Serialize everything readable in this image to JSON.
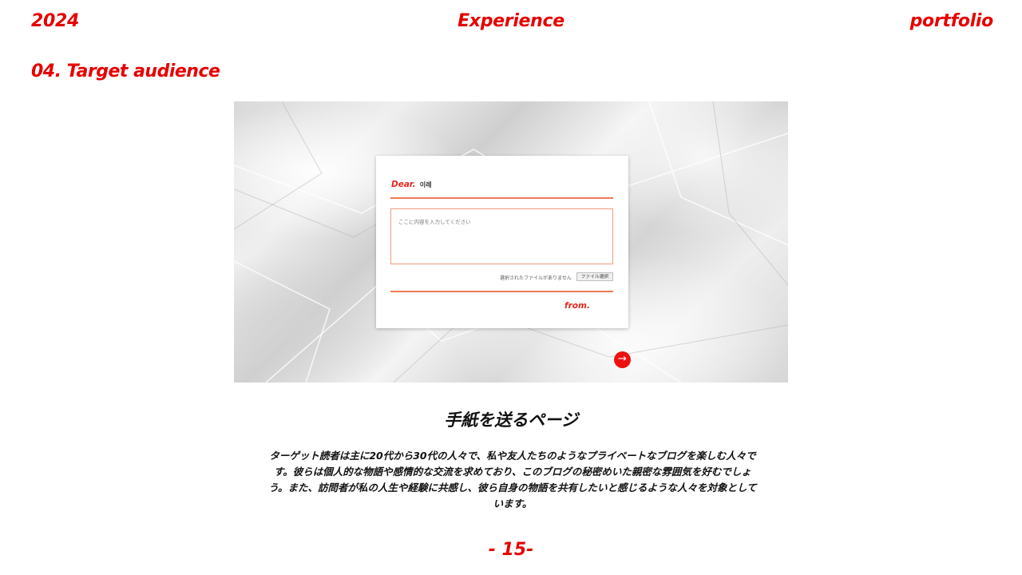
{
  "header": {
    "year": "2024",
    "title": "Experience",
    "right": "portfolio"
  },
  "section_title": "04. Target audience",
  "screenshot": {
    "dear_label": "Dear.",
    "dear_name": "이레",
    "message_placeholder": "ここに内容を入力してください",
    "file_status": "選択されたファイルがありません",
    "file_button": "ファイル選択",
    "from_label": "from.",
    "next_arrow": "→"
  },
  "caption": {
    "title": "手紙を送るページ",
    "body": "ターゲット読者は主に20代から30代の人々で、私や友人たちのようなプライベートなブログを楽しむ人々です。彼らは個人的な物語や感情的な交流を求めており、このブログの秘密めいた親密な雰囲気を好むでしょう。また、訪問者が私の人生や経験に共感し、彼ら自身の物語を共有したいと感じるような人々を対象としています。"
  },
  "page_number": "- 15-",
  "colors": {
    "accent": "#e60000",
    "rule": "#f07a55"
  }
}
